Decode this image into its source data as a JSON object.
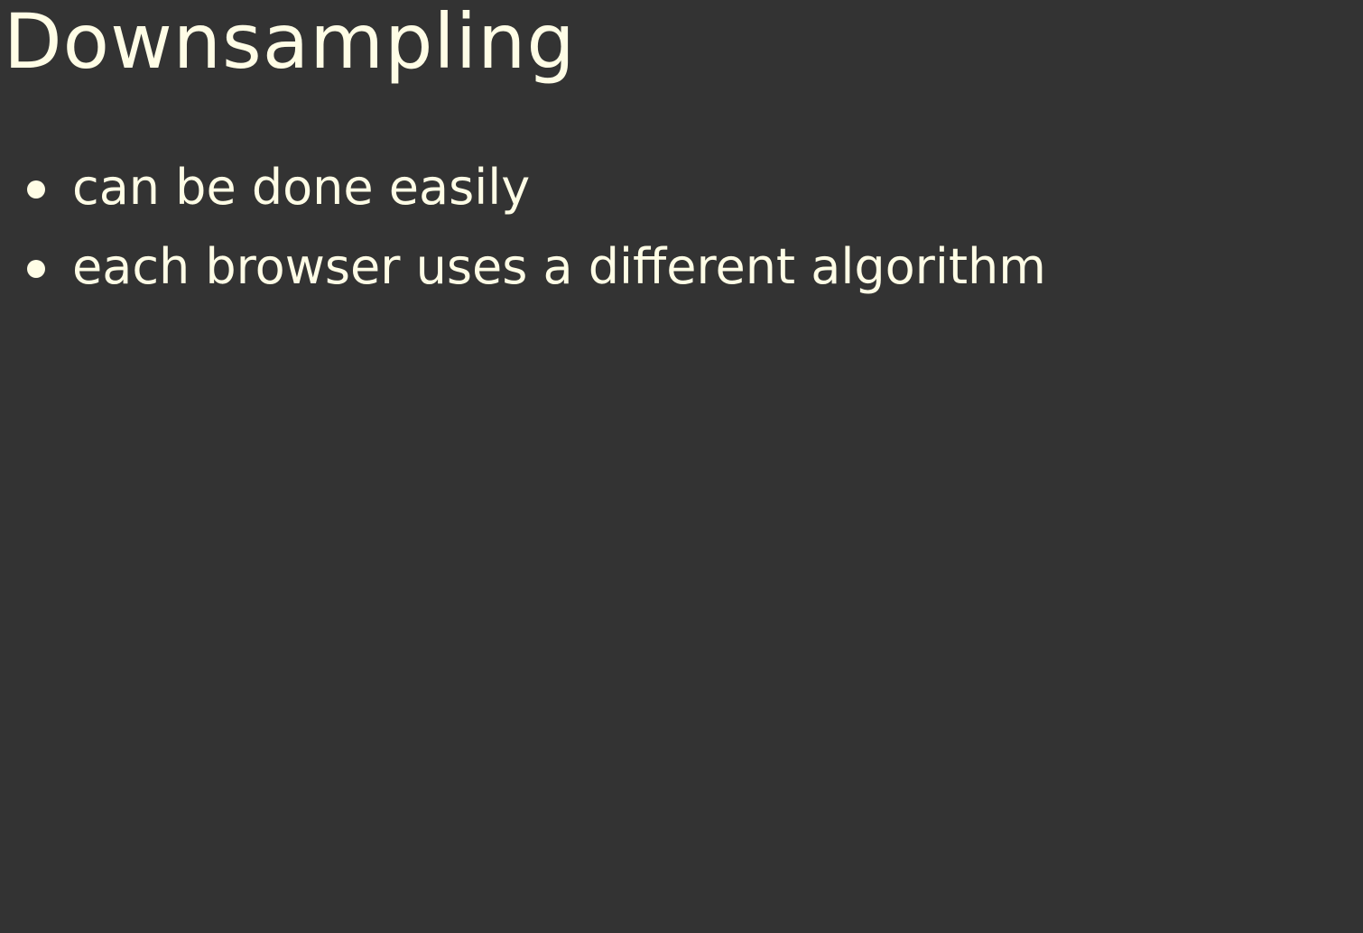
{
  "slide": {
    "title": "Downsampling",
    "bullets": [
      {
        "text": "can be done easily"
      },
      {
        "text": "each browser uses a different algorithm"
      }
    ]
  },
  "colors": {
    "background": "#333333",
    "text": "#fffde6"
  }
}
